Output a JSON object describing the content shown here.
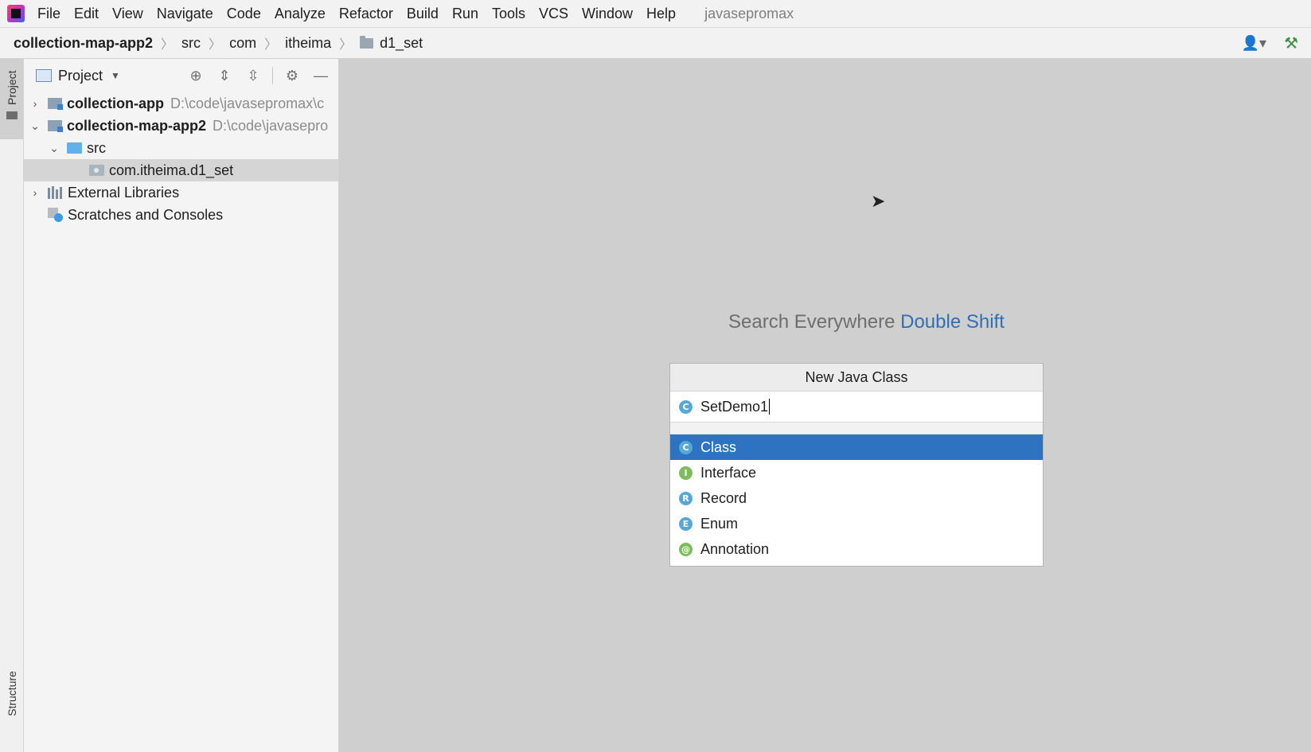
{
  "menubar": {
    "items": [
      "File",
      "Edit",
      "View",
      "Navigate",
      "Code",
      "Analyze",
      "Refactor",
      "Build",
      "Run",
      "Tools",
      "VCS",
      "Window",
      "Help"
    ],
    "project_title": "javasepromax"
  },
  "breadcrumb": {
    "items": [
      "collection-map-app2",
      "src",
      "com",
      "itheima",
      "d1_set"
    ]
  },
  "sidebar": {
    "project_tab": "Project",
    "structure_tab": "Structure"
  },
  "project_panel": {
    "view_label": "Project",
    "tree": [
      {
        "label": "collection-app",
        "path": "D:\\code\\javasepromax\\c"
      },
      {
        "label": "collection-map-app2",
        "path": "D:\\code\\javasepro"
      },
      {
        "label": "src"
      },
      {
        "label": "com.itheima.d1_set"
      },
      {
        "label": "External Libraries"
      },
      {
        "label": "Scratches and Consoles"
      }
    ]
  },
  "editor": {
    "hint_prefix": "Search Everywhere",
    "hint_shortcut": "Double Shift"
  },
  "dialog": {
    "title": "New Java Class",
    "input_value": "SetDemo1",
    "kinds": [
      {
        "label": "Class",
        "icon": "C",
        "selected": true
      },
      {
        "label": "Interface",
        "icon": "I"
      },
      {
        "label": "Record",
        "icon": "R"
      },
      {
        "label": "Enum",
        "icon": "E"
      },
      {
        "label": "Annotation",
        "icon": "@"
      }
    ]
  },
  "colors": {
    "selection": "#2e73c2",
    "accent_text": "#2f6fb4",
    "editor_bg": "#cfcfcf"
  }
}
